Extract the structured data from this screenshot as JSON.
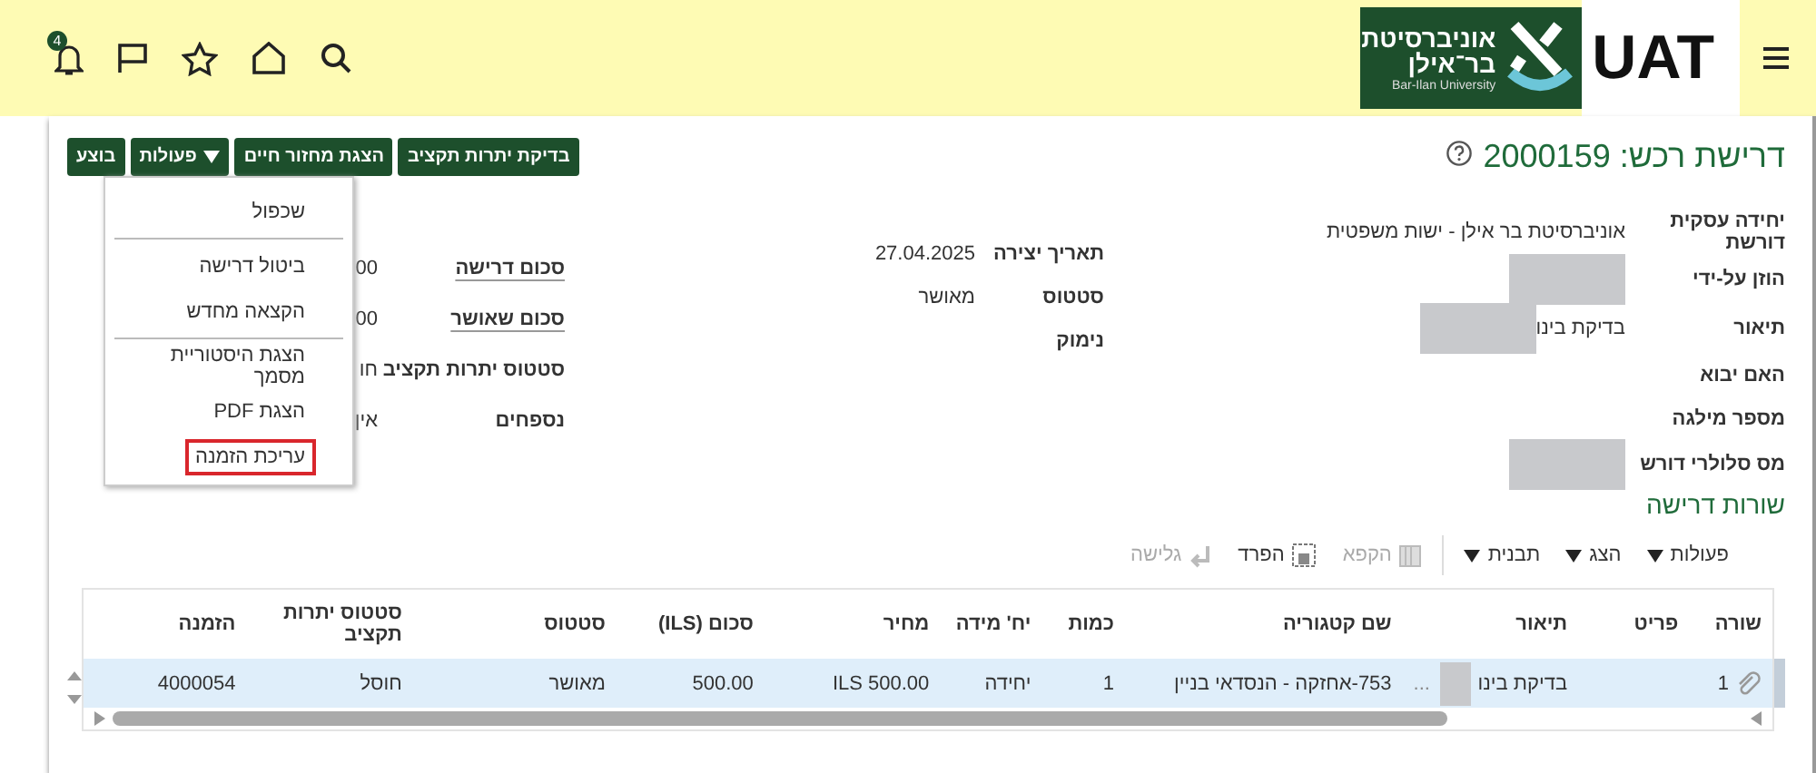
{
  "header": {
    "notification_count": "4",
    "logo": {
      "hebrew_lines": [
        "אוניברסיטת",
        "בר־אילן"
      ],
      "english": "Bar-Ilan University"
    },
    "environment": "UAT"
  },
  "page": {
    "title": "דרישת רכש: 2000159"
  },
  "actions": [
    {
      "label": "בדיקת יתרות תקציב",
      "kind": "button"
    },
    {
      "label": "הצגת מחזור חיים",
      "kind": "button"
    },
    {
      "label": "פעולות",
      "kind": "dropdown"
    },
    {
      "label": "בוצע",
      "kind": "button"
    }
  ],
  "actions_menu": [
    {
      "label": "שכפול",
      "kind": "item",
      "selected": false
    },
    {
      "kind": "divider"
    },
    {
      "label": "ביטול דרישה",
      "kind": "item",
      "selected": false
    },
    {
      "label": "הקצאה מחדש",
      "kind": "item",
      "selected": false
    },
    {
      "kind": "divider"
    },
    {
      "label": "הצגת היסטוריית מסמך",
      "kind": "item",
      "selected": false
    },
    {
      "label": "הצגת PDF",
      "kind": "item",
      "selected": false
    },
    {
      "label": "עריכת הזמנה",
      "kind": "item",
      "selected": true
    }
  ],
  "details": [
    [
      {
        "label": "יחידה עסקית דורשת",
        "value": "אוניברסיטת בר אילן - ישות משפטית",
        "redacted": false
      },
      {
        "label": "הוזן על-ידי",
        "redacted": true
      },
      {
        "label": "תיאור",
        "value": "בדיקת בינו",
        "redacted": true
      },
      {
        "label": "האם יבוא",
        "redacted": false
      },
      {
        "label": "מספר מילגה",
        "redacted": false
      },
      {
        "label": "מס סלולרי דורש",
        "redacted": true
      }
    ],
    [
      {
        "label": "תאריך יצירה",
        "value": "27.04.2025",
        "redacted": false
      },
      {
        "label": "סטטוס",
        "value": "מאושר",
        "redacted": false
      },
      {
        "label": "נימוק",
        "redacted": false
      }
    ],
    [
      {
        "label": "סכום דרישה",
        "value": "00",
        "link": true
      },
      {
        "label": "סכום שאושר",
        "value": "00",
        "link": true
      },
      {
        "label": "סטטוס יתרות תקציב",
        "value": "חו",
        "link": false
      },
      {
        "label": "נספחים",
        "value": "אין",
        "link": false
      }
    ]
  ],
  "lines": {
    "title": "שורות דרישה",
    "toolbar": [
      {
        "label": "פעולות",
        "kind": "menu",
        "disabled": false
      },
      {
        "label": "הצג",
        "kind": "menu",
        "disabled": false
      },
      {
        "label": "תבנית",
        "kind": "menu",
        "disabled": false
      },
      {
        "label": "הקפא",
        "kind": "freeze",
        "disabled": true
      },
      {
        "label": "הפרד",
        "kind": "detach",
        "disabled": false
      },
      {
        "label": "גלישה",
        "kind": "wrap",
        "disabled": true
      }
    ],
    "columns": [
      "שורה",
      "פריט",
      "תיאור",
      "שם קטגוריה",
      "כמות",
      "יח' מידה",
      "מחיר",
      "סכום (ILS)",
      "סטטוס",
      "סטטוס יתרות תקציב",
      "הזמנה"
    ],
    "rows": [
      {
        "selected": true,
        "attachment": true,
        "description_redacted": true,
        "cells": [
          "1",
          "",
          "בדיקת בינו",
          "753-אחזקה - הנסדאי בניין",
          "1",
          "יחידה",
          "ILS 500.00",
          "500.00",
          "מאושר",
          "חוסל",
          "4000054"
        ],
        "description_ellipsis": "..."
      }
    ]
  }
}
